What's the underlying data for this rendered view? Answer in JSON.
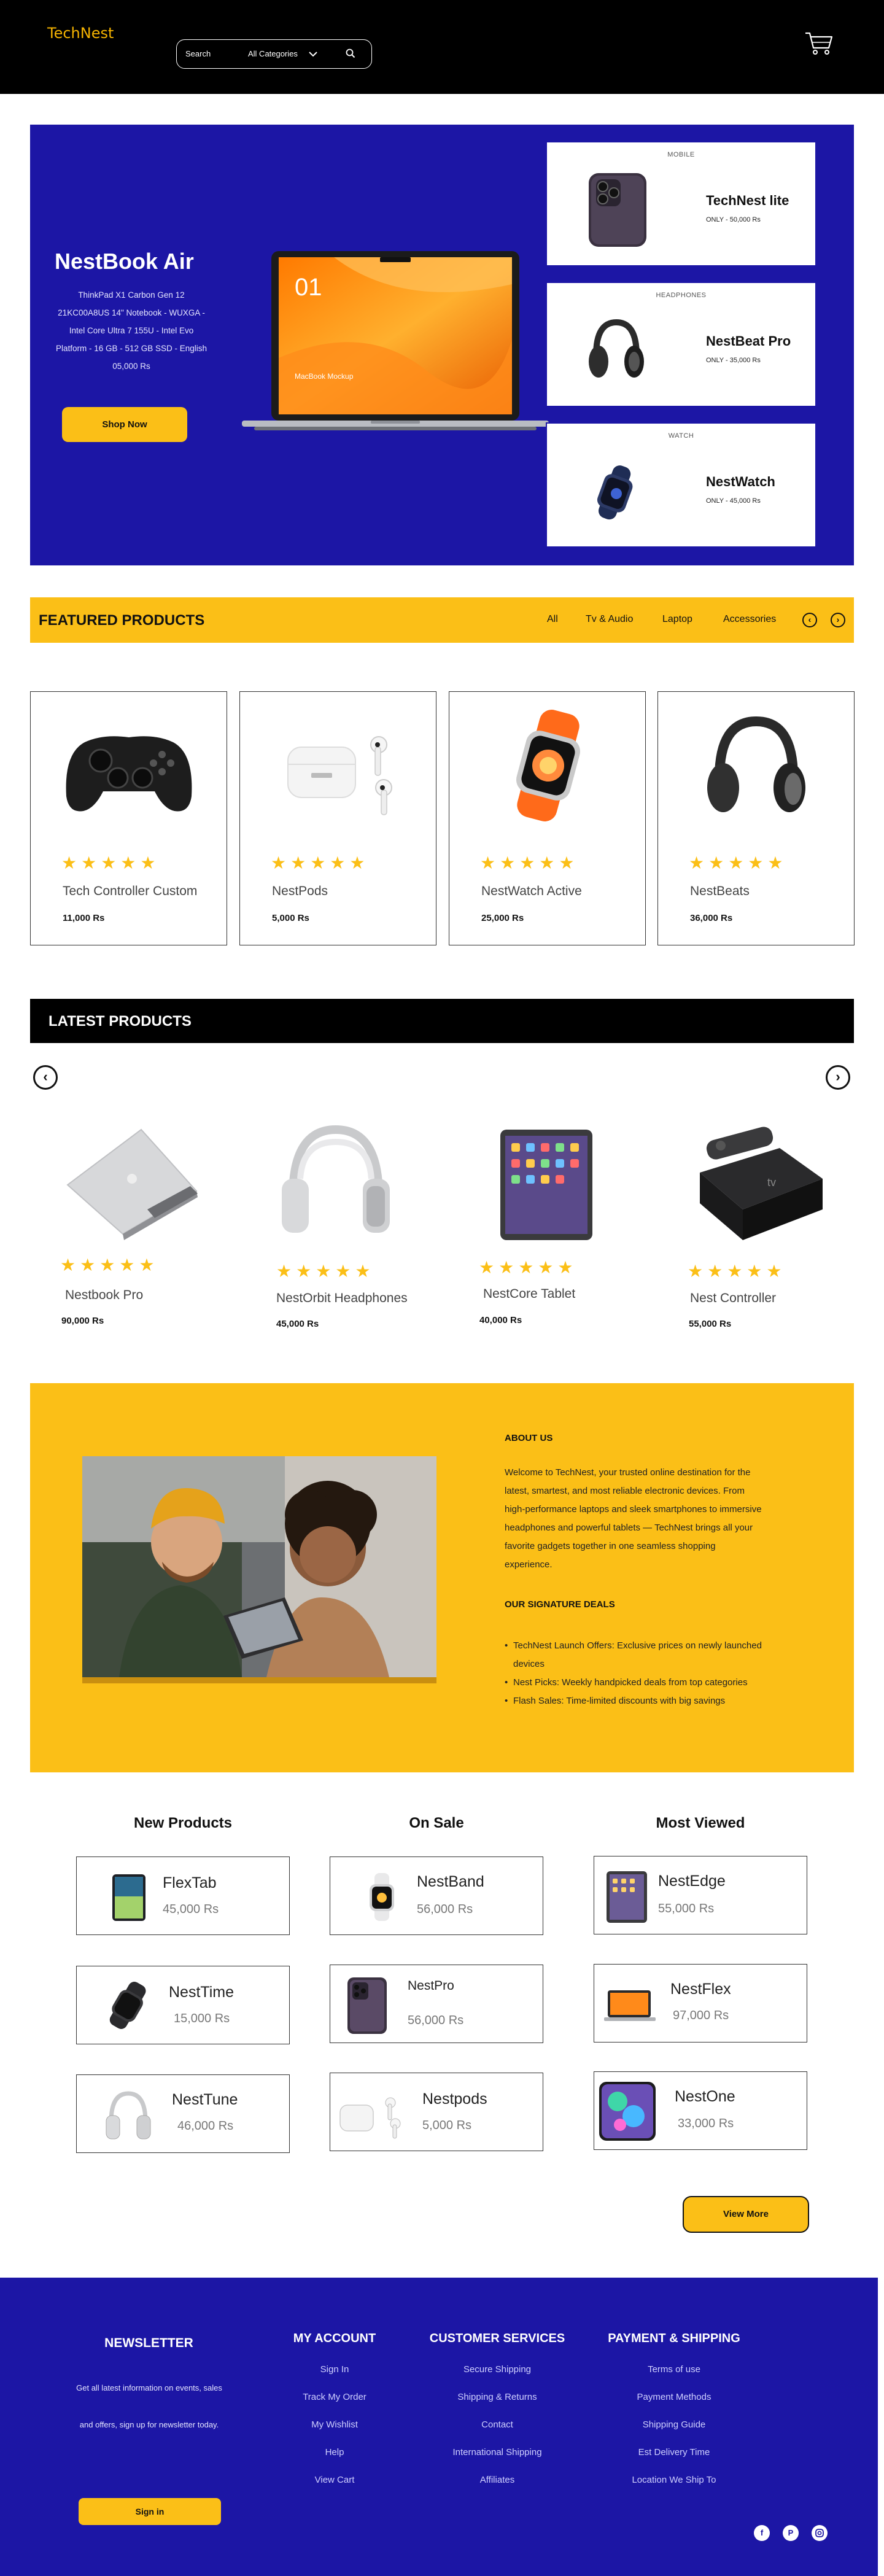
{
  "header": {
    "logo": "TechNest",
    "search_label": "Search",
    "category": "All Categories"
  },
  "hero": {
    "title": "NestBook Air",
    "description": "ThinkPad X1 Carbon Gen 12 21KC00A8US 14\" Notebook - WUXGA - Intel Core Ultra 7 155U - Intel Evo Platform - 16 GB - 512 GB SSD - English 05,000 Rs",
    "button": "Shop Now",
    "laptop_screen_text": "01",
    "laptop_screen_caption": "MacBook Mockup",
    "promos": [
      {
        "category": "MOBILE",
        "name": "TechNest lite",
        "price": "ONLY - 50,000 Rs"
      },
      {
        "category": "HEADPHONES",
        "name": "NestBeat Pro",
        "price": "ONLY - 35,000 Rs"
      },
      {
        "category": "WATCH",
        "name": "NestWatch",
        "price": "ONLY - 45,000 Rs"
      }
    ]
  },
  "featured": {
    "title": "FEATURED PRODUCTS",
    "tabs": [
      "All",
      "Tv & Audio",
      "Laptop",
      "Accessories"
    ],
    "stars": "★★★★★",
    "products": [
      {
        "name": "Tech Controller Custom",
        "price": "11,000 Rs",
        "icon": "game-controller"
      },
      {
        "name": "NestPods",
        "price": "5,000 Rs",
        "icon": "earbuds"
      },
      {
        "name": "NestWatch Active",
        "price": "25,000 Rs",
        "icon": "smartwatch"
      },
      {
        "name": "NestBeats",
        "price": "36,000 Rs",
        "icon": "headphones"
      }
    ]
  },
  "latest": {
    "title": "LATEST PRODUCTS",
    "stars": "★★★★★",
    "products": [
      {
        "name": "Nestbook Pro",
        "price": "90,000 Rs",
        "icon": "laptop"
      },
      {
        "name": "NestOrbit Headphones",
        "price": "45,000 Rs",
        "icon": "headphones"
      },
      {
        "name": "NestCore Tablet",
        "price": "40,000 Rs",
        "icon": "tablet"
      },
      {
        "name": "Nest Controller",
        "price": "55,000 Rs",
        "icon": "tv-box"
      }
    ]
  },
  "about": {
    "heading": "ABOUT US",
    "text": "Welcome to TechNest, your trusted online destination for the latest, smartest, and most reliable electronic devices. From high-performance laptops and sleek smartphones to immersive headphones and powerful tablets — TechNest brings all your favorite gadgets together in one seamless shopping experience.",
    "deals_heading": "OUR SIGNATURE DEALS",
    "deals": [
      "TechNest Launch Offers: Exclusive prices on newly launched devices",
      "Nest Picks: Weekly handpicked deals from top categories",
      "Flash Sales: Time-limited discounts with big savings"
    ]
  },
  "lists": {
    "columns": [
      {
        "title": "New Products",
        "items": [
          {
            "name": "FlexTab",
            "price": "45,000 Rs",
            "icon": "tablet"
          },
          {
            "name": "NestTime",
            "price": "15,000 Rs",
            "icon": "smartwatch"
          },
          {
            "name": "NestTune",
            "price": "46,000 Rs",
            "icon": "headphones"
          }
        ]
      },
      {
        "title": "On Sale",
        "items": [
          {
            "name": "NestBand",
            "price": "56,000 Rs",
            "icon": "smartwatch"
          },
          {
            "name": "NestPro",
            "price": "56,000 Rs",
            "icon": "phone"
          },
          {
            "name": "Nestpods",
            "price": "5,000 Rs",
            "icon": "earbuds"
          }
        ]
      },
      {
        "title": "Most Viewed",
        "items": [
          {
            "name": "NestEdge",
            "price": "55,000 Rs",
            "icon": "tablet"
          },
          {
            "name": "NestFlex",
            "price": "97,000 Rs",
            "icon": "laptop"
          },
          {
            "name": "NestOne",
            "price": "33,000 Rs",
            "icon": "phone"
          }
        ]
      }
    ],
    "view_more": "View More"
  },
  "footer": {
    "newsletter_title": "NEWSLETTER",
    "newsletter_text": "Get all latest information on events, sales and offers, sign up for newsletter today.",
    "sign_in": "Sign in",
    "columns": [
      {
        "title": "MY ACCOUNT",
        "links": [
          "Sign In",
          "Track My Order",
          "My Wishlist",
          "Help",
          "View Cart"
        ]
      },
      {
        "title": "CUSTOMER SERVICES",
        "links": [
          "Secure Shipping",
          "Shipping & Returns",
          "Contact",
          "International Shipping",
          "Affiliates"
        ]
      },
      {
        "title": "PAYMENT & SHIPPING",
        "links": [
          "Terms of use",
          "Payment Methods",
          "Shipping Guide",
          "Est Delivery Time",
          "Location We Ship To"
        ]
      }
    ],
    "social": [
      "facebook-icon",
      "pinterest-icon",
      "instagram-icon"
    ]
  },
  "colors": {
    "brand_blue": "#1c16a5",
    "accent_yellow": "#fbbf17",
    "header_black": "#000000"
  }
}
